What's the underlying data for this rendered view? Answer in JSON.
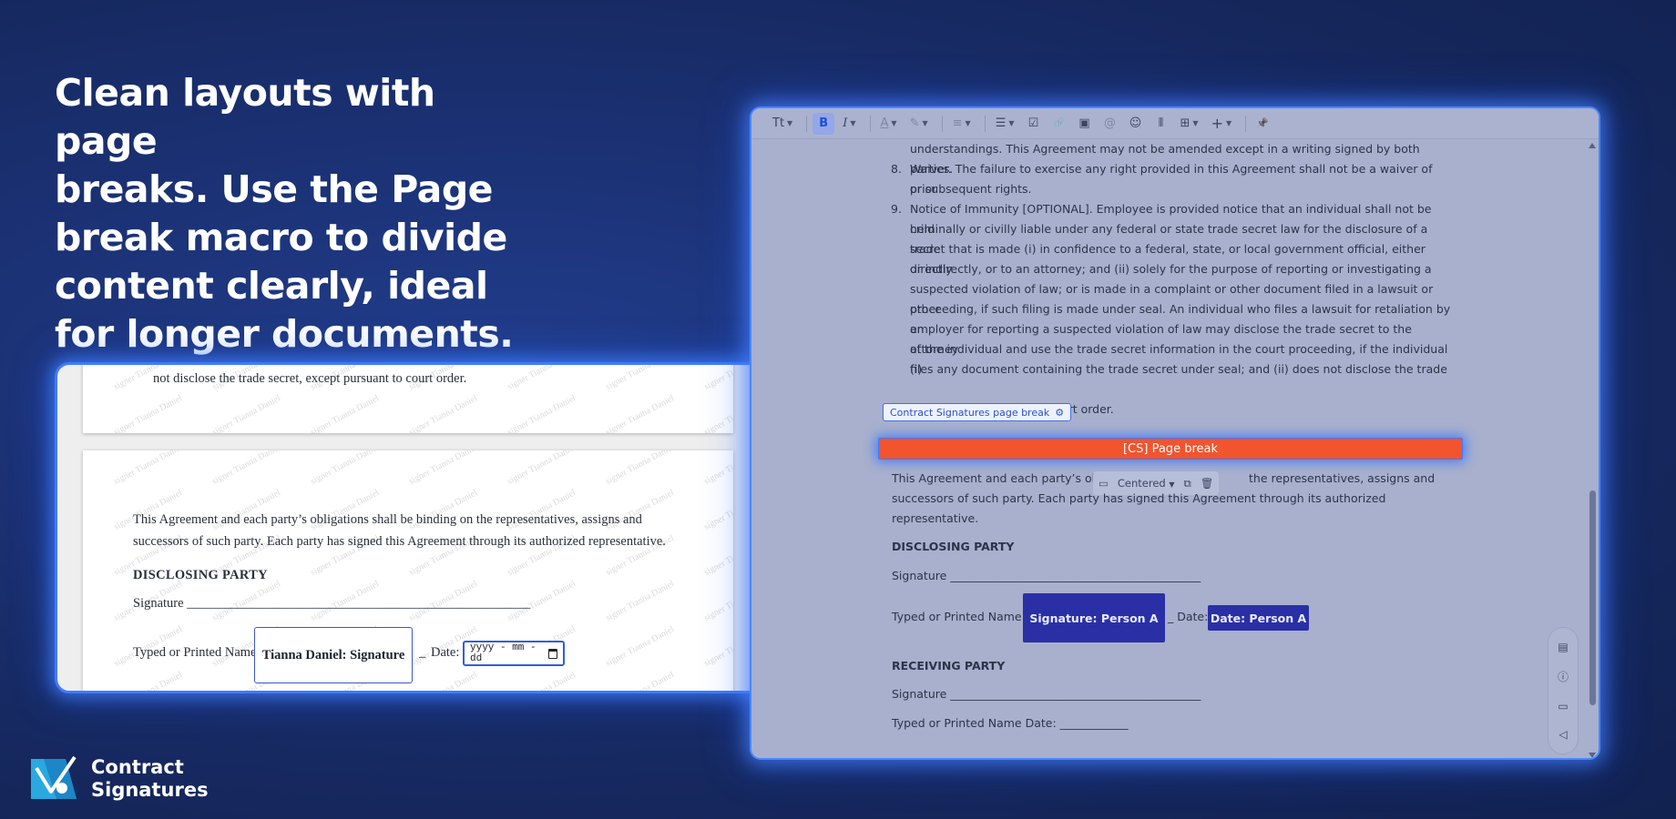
{
  "headline": [
    "Clean layouts with page",
    "breaks. Use the Page",
    "break macro to divide",
    "content clearly, ideal",
    "for longer documents."
  ],
  "preview": {
    "watermark": "signer Tianna Daniel",
    "page1_text": "not disclose the trade secret, except pursuant to court order.",
    "page2_paragraph": "This Agreement and each party’s obligations shall be binding on the representatives, assigns and successors of such party. Each party has signed this Agreement through its authorized representative.",
    "disclosing_heading": "DISCLOSING PARTY",
    "signature_line": "Signature ____________________________________________________",
    "typed_label": "Typed or Printed Name",
    "signature_box": "Tianna Daniel: Signature",
    "underscore": "_",
    "date_label": "Date:",
    "date_placeholder": "yyyy - mm - dd"
  },
  "editor": {
    "toolbar": {
      "text_style": "Tt",
      "bold": "B",
      "italic": "I",
      "text_color": "A",
      "highlight": "✎",
      "align": "≡",
      "list": "☰",
      "task": "☑",
      "link": "🔗",
      "image": "▣",
      "mention": "@",
      "emoji": "☺",
      "columns": "⫴",
      "table": "⊞",
      "insert": "+",
      "pin": "📌"
    },
    "lines": [
      "understandings. This Agreement may not be amended except in a writing signed by both parties.",
      "Waiver. The failure to exercise any right provided in this Agreement shall not be a waiver of prior",
      "or subsequent rights.",
      "Notice of Immunity [OPTIONAL]. Employee is provided notice that an individual shall not be held",
      "criminally or civilly liable under any federal or state trade secret law for the disclosure of a trade",
      "secret that is made (i) in confidence to a federal, state, or local government official, either directly",
      "or indirectly, or to an attorney; and (ii) solely for the purpose of reporting or investigating a",
      "suspected violation of law; or is made in a complaint or other document filed in a lawsuit or other",
      "proceeding, if such filing is made under seal. An individual who files a lawsuit for retaliation by an",
      "employer for reporting a suspected violation of law may disclose the trade secret to the attorney",
      "of the individual and use the trade secret information in the court proceeding, if the individual (i)",
      "files any document containing the trade secret under seal; and (ii) does not disclose the trade",
      "ourt order."
    ],
    "num8": "8.",
    "num9": "9.",
    "page_break_label": "Contract Signatures page break",
    "page_break_bar": "[CS] Page break",
    "float_toolbar": {
      "alignment": "Centered"
    },
    "binding_para_1": "This Agreement and each party’s obl",
    "binding_para_1b": "the representatives, assigns and",
    "binding_para_2": "successors of such party. Each party has signed this Agreement through its authorized",
    "binding_para_3": "representative.",
    "disclosing_heading": "DISCLOSING PARTY",
    "signature_line": "Signature ____________________________________________",
    "typed_label": "Typed or Printed Name",
    "signature_button": "Signature: Person A",
    "date_sep": "_ Date:",
    "date_button": "Date: Person A",
    "receiving_heading": "RECEIVING PARTY",
    "receiving_signature_line": "Signature ____________________________________________",
    "receiving_typed_line": "Typed or Printed Name Date: ____________"
  },
  "logo": {
    "line1": "Contract",
    "line2": "Signatures"
  }
}
